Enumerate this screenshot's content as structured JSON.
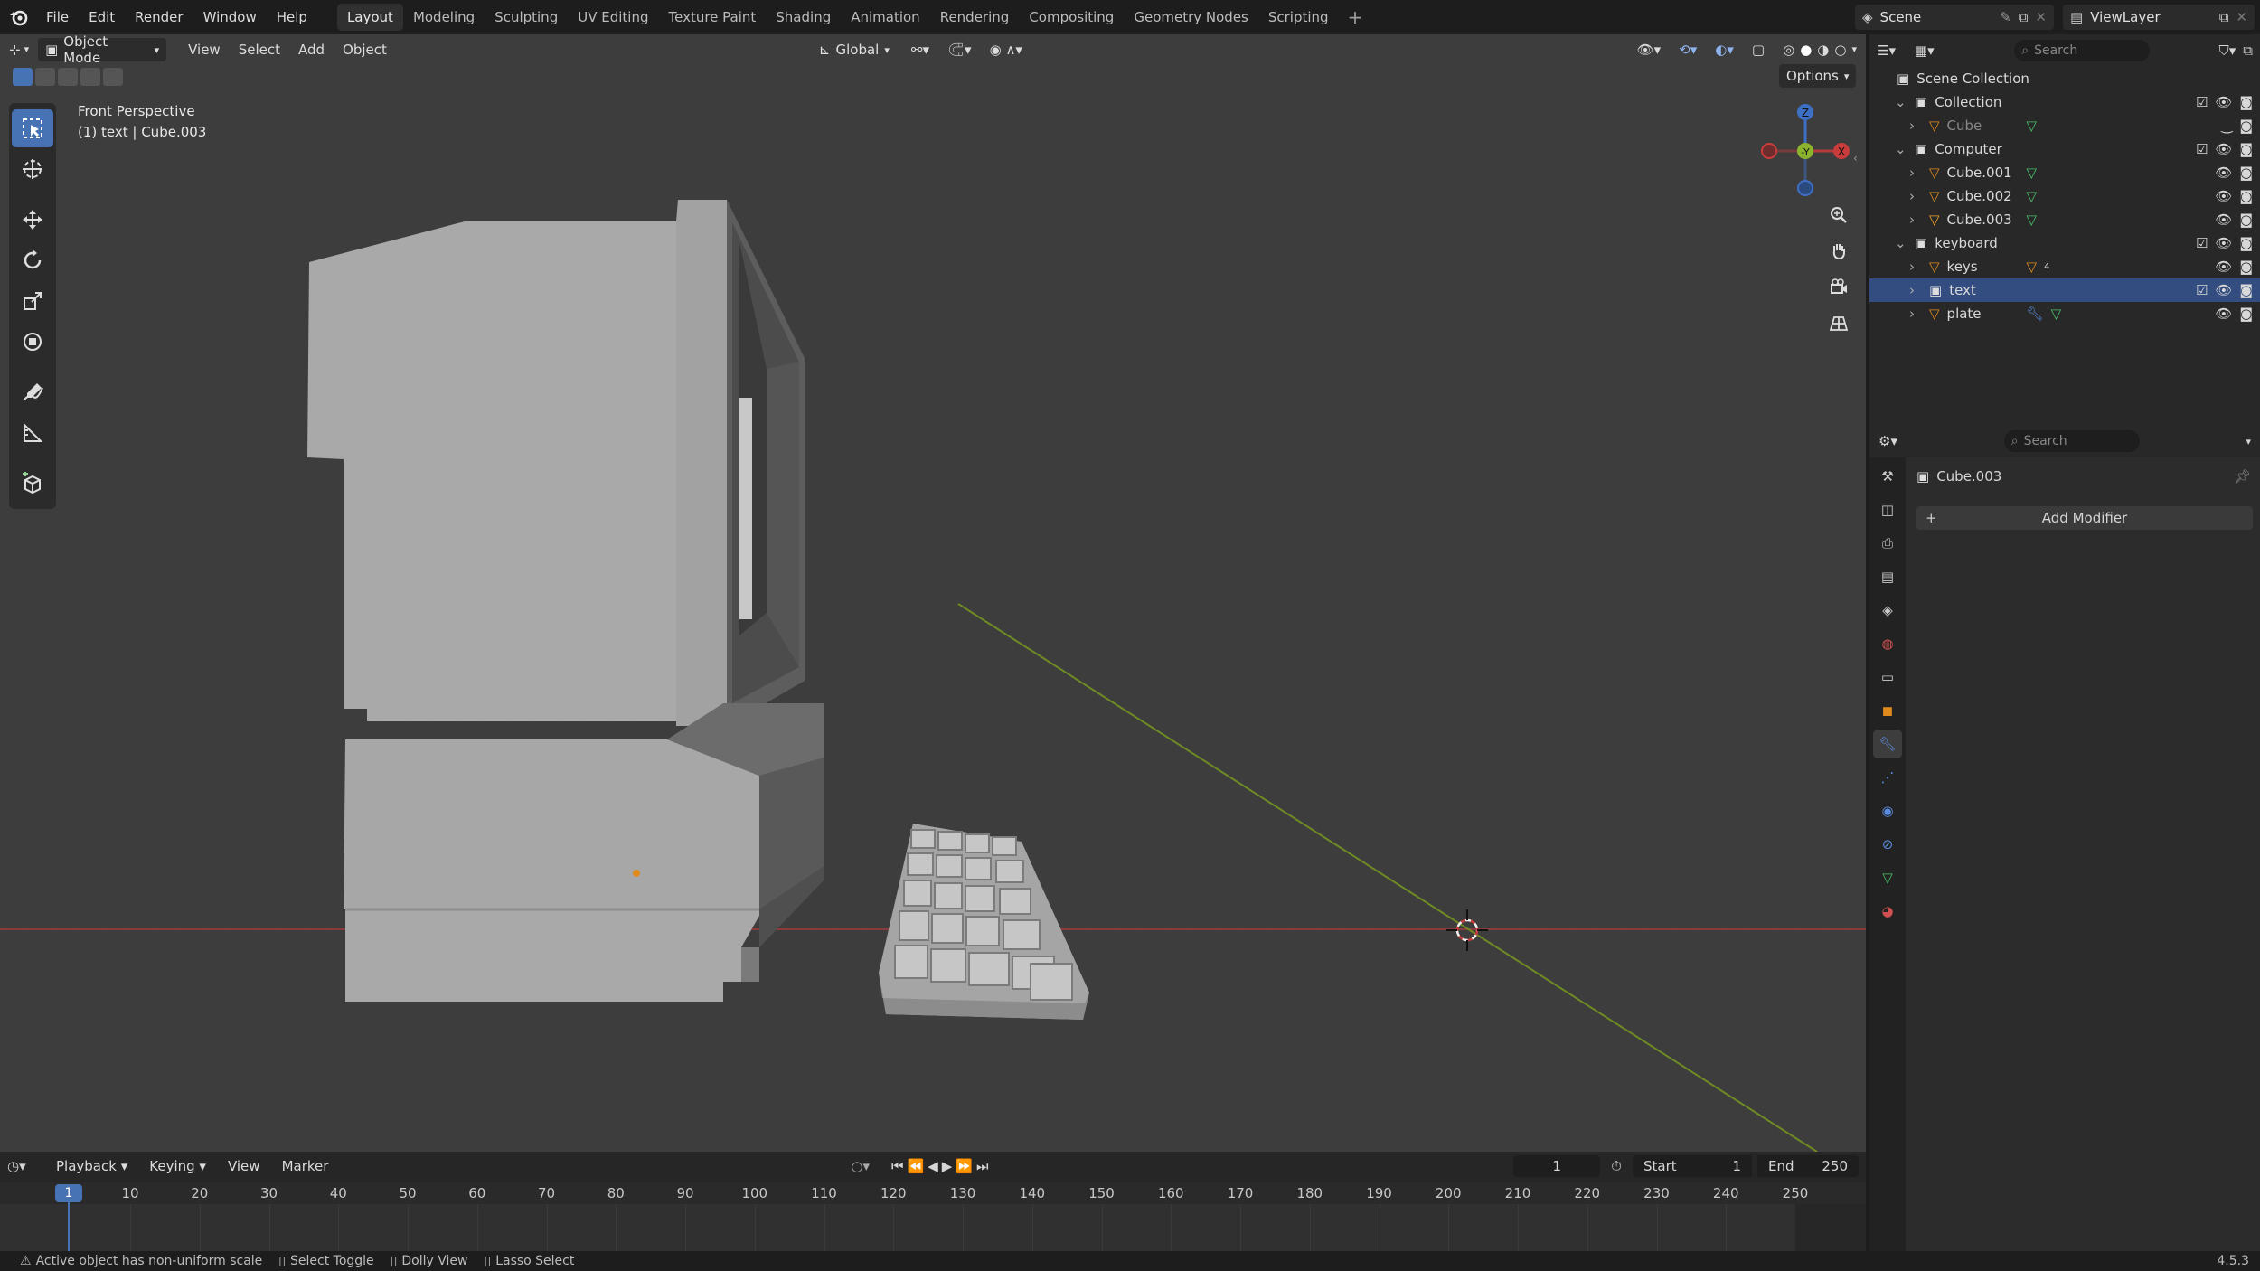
{
  "app": {
    "version": "4.5.3"
  },
  "menus": [
    "File",
    "Edit",
    "Render",
    "Window",
    "Help"
  ],
  "workspaces": [
    "Layout",
    "Modeling",
    "Sculpting",
    "UV Editing",
    "Texture Paint",
    "Shading",
    "Animation",
    "Rendering",
    "Compositing",
    "Geometry Nodes",
    "Scripting"
  ],
  "active_workspace": "Layout",
  "scene": {
    "name": "Scene",
    "view_layer": "ViewLayer"
  },
  "viewport": {
    "mode": "Object Mode",
    "menus": [
      "View",
      "Select",
      "Add",
      "Object"
    ],
    "transform_orientation": "Global",
    "options_label": "Options",
    "view_name": "Front Perspective",
    "object_info": "(1) text | Cube.003",
    "gizmo_labels": {
      "z": "Z",
      "y": "-Y",
      "x": "X"
    }
  },
  "outliner": {
    "search_placeholder": "Search",
    "root": "Scene Collection",
    "rows": [
      {
        "name": "Collection",
        "type": "collection",
        "level": 0,
        "expanded": true
      },
      {
        "name": "Cube",
        "type": "object",
        "level": 1,
        "dim": true
      },
      {
        "name": "Computer",
        "type": "collection",
        "level": 0,
        "expanded": true
      },
      {
        "name": "Cube.001",
        "type": "object",
        "level": 1
      },
      {
        "name": "Cube.002",
        "type": "object",
        "level": 1
      },
      {
        "name": "Cube.003",
        "type": "object",
        "level": 1,
        "active": true
      },
      {
        "name": "keyboard",
        "type": "collection",
        "level": 0,
        "expanded": true
      },
      {
        "name": "keys",
        "type": "object",
        "level": 1,
        "badge": "4"
      },
      {
        "name": "text",
        "type": "text",
        "level": 1,
        "selected": true
      },
      {
        "name": "plate",
        "type": "object",
        "level": 1,
        "modifier": true
      }
    ]
  },
  "properties": {
    "search_placeholder": "Search",
    "object_name": "Cube.003",
    "add_modifier_label": "Add Modifier"
  },
  "timeline": {
    "menus": [
      "Playback",
      "Keying",
      "View",
      "Marker"
    ],
    "current_frame": "1",
    "start_label": "Start",
    "start": "1",
    "end_label": "End",
    "end": "250",
    "ticks": [
      "10",
      "20",
      "30",
      "40",
      "50",
      "60",
      "70",
      "80",
      "90",
      "100",
      "110",
      "120",
      "130",
      "140",
      "150",
      "160",
      "170",
      "180",
      "190",
      "200",
      "210",
      "220",
      "230",
      "240",
      "250"
    ],
    "frame_marker": "1"
  },
  "status": {
    "warning": "Active object has non-uniform scale",
    "hints": [
      "Select Toggle",
      "Dolly View",
      "Lasso Select"
    ]
  },
  "colors": {
    "accent": "#4772b3",
    "x_axis": "#b33b3b",
    "y_axis": "#8cb32d",
    "z_axis": "#3d6fc4",
    "selection": "#334d80"
  }
}
